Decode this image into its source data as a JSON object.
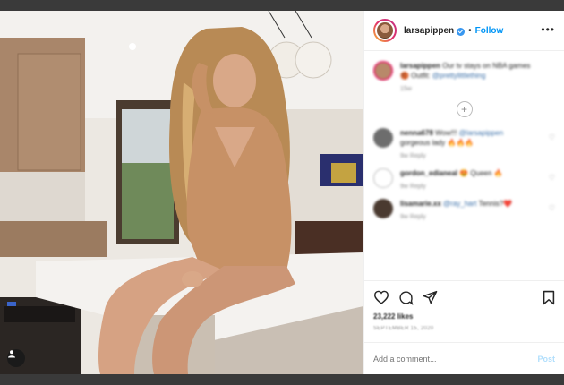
{
  "post": {
    "username": "larsapippen",
    "follow_label": "Follow",
    "dot_separator": "•",
    "more_label": "•••"
  },
  "comments": [
    {
      "user": "larsapippen",
      "text": "Our tv stays on NBA games 🏀 Outfit: ",
      "link": "@prettylittlething",
      "meta": "15w",
      "avatar_color": "#b8896a"
    },
    {
      "user": "nenna678",
      "text": "Wow!!! ",
      "link": "@larsapippen",
      "text2": " gorgeous lady 🔥🔥🔥",
      "meta": "9w   Reply",
      "avatar_color": "#6d6d6d"
    },
    {
      "user": "gordon_edianeal",
      "text": "😍 Queen 🔥",
      "link": "",
      "meta": "9w   Reply",
      "avatar_color": "#ffffff"
    },
    {
      "user": "lisamarie.xx",
      "text": " ",
      "link": "@ray_hart",
      "text2": " Tennis?❤️",
      "meta": "9w   Reply",
      "avatar_color": "#4a3a30"
    }
  ],
  "actions": {
    "likes": "23,222 likes",
    "date": "SEPTEMBER 15, 2020"
  },
  "comment_box": {
    "placeholder": "Add a comment...",
    "post_label": "Post"
  },
  "icons": {
    "like": "heart-icon",
    "comment": "comment-icon",
    "share": "paper-plane-icon",
    "save": "bookmark-icon",
    "tagged": "person-tag-icon",
    "load_more": "plus-circle-icon"
  },
  "colors": {
    "follow": "#0095f6",
    "verified": "#3897f0",
    "post_disabled": "#b2dffc"
  }
}
